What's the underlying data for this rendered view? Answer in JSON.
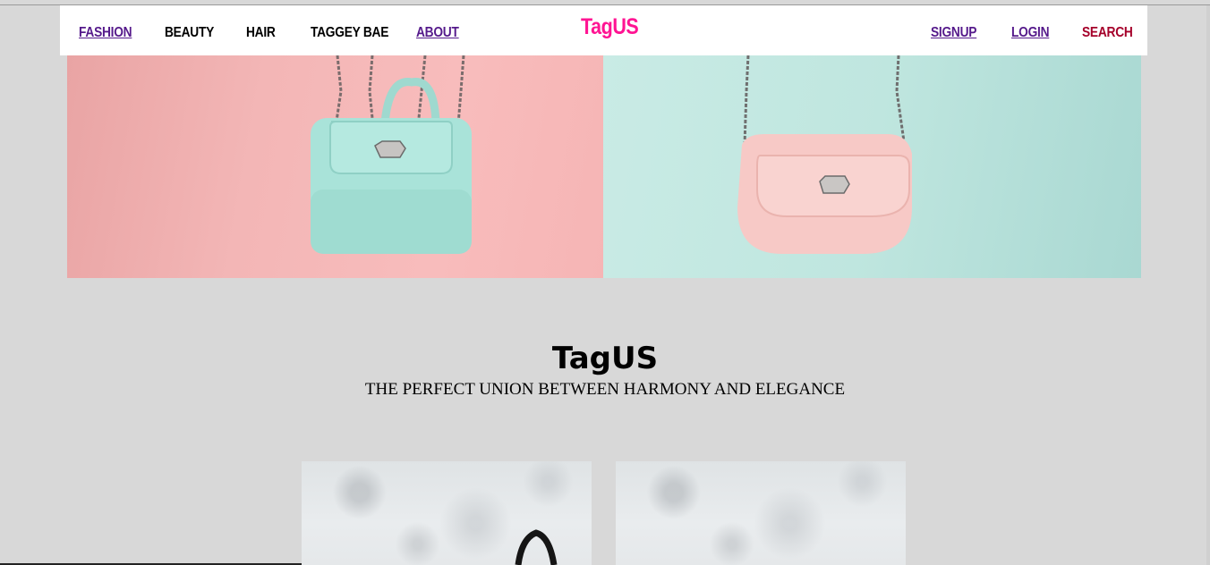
{
  "nav": {
    "fashion": "FASHION",
    "beauty": "BEAUTY",
    "hair": "HAIR",
    "taggey_bae": "TAGGEY BAE",
    "about": "ABOUT",
    "brand": "TagUS",
    "signup": "SIGNUP",
    "login": "LOGIN",
    "search": "SEARCH"
  },
  "section": {
    "title": "TagUS",
    "subtitle": "THE PERFECT UNION BETWEEN HARMONY AND ELEGANCE"
  },
  "colors": {
    "page_bg": "#d8d8d8",
    "brand": "#ff1493",
    "visited_link": "#551a8b",
    "search_link": "#a5002a",
    "hero_left_bg": "#f3b6b6",
    "hero_right_bg": "#bfe6df",
    "bag_mint": "#a9e3d9",
    "bag_pink": "#f7c9c6"
  }
}
